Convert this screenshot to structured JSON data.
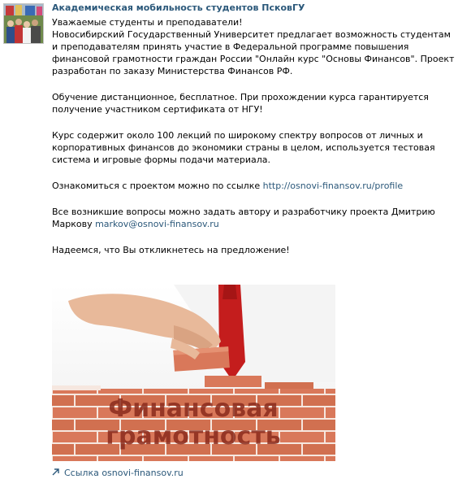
{
  "post": {
    "author": "Академическая мобильность студентов ПсковГУ",
    "greeting": "Уважаемые студенты и преподаватели!",
    "intro": "Новосибирский Государственный Университет предлагает возможность студентам и преподавателям принять участие в Федеральной программе повышения финансовой грамотности граждан России \"Онлайн курс \"Основы Финансов\". Проект разработан по заказу Министерства Финансов РФ.",
    "paragraph2": "Обучение дистанционное, бесплатное. При прохождении курса гарантируется получение участником сертификата от НГУ!",
    "paragraph3": "Курс содержит около 100 лекций по широкому спектру вопросов от личных и корпоративных финансов до экономики страны в целом, используется тестовая система и игровые формы подачи материала.",
    "paragraph4_prefix": "Ознакомиться с проектом можно по ссылке ",
    "project_link": "http://osnovi-finansov.ru/profile",
    "paragraph5_prefix": "Все возникшие вопросы можно задать автору и разработчику проекта Дмитрию Маркову ",
    "email": "markov@osnovi-finansov.ru",
    "closing": "Надеемся, что Вы откликнетесь на предложение!"
  },
  "image": {
    "line1": "Финансовая",
    "line2": "грамотность"
  },
  "attachment": {
    "label": "Ссылка osnovi-finansov.ru"
  },
  "colors": {
    "link": "#2b587a",
    "brick": "#d9785a",
    "mortar": "#f6e7df",
    "tie": "#c41d1d"
  }
}
